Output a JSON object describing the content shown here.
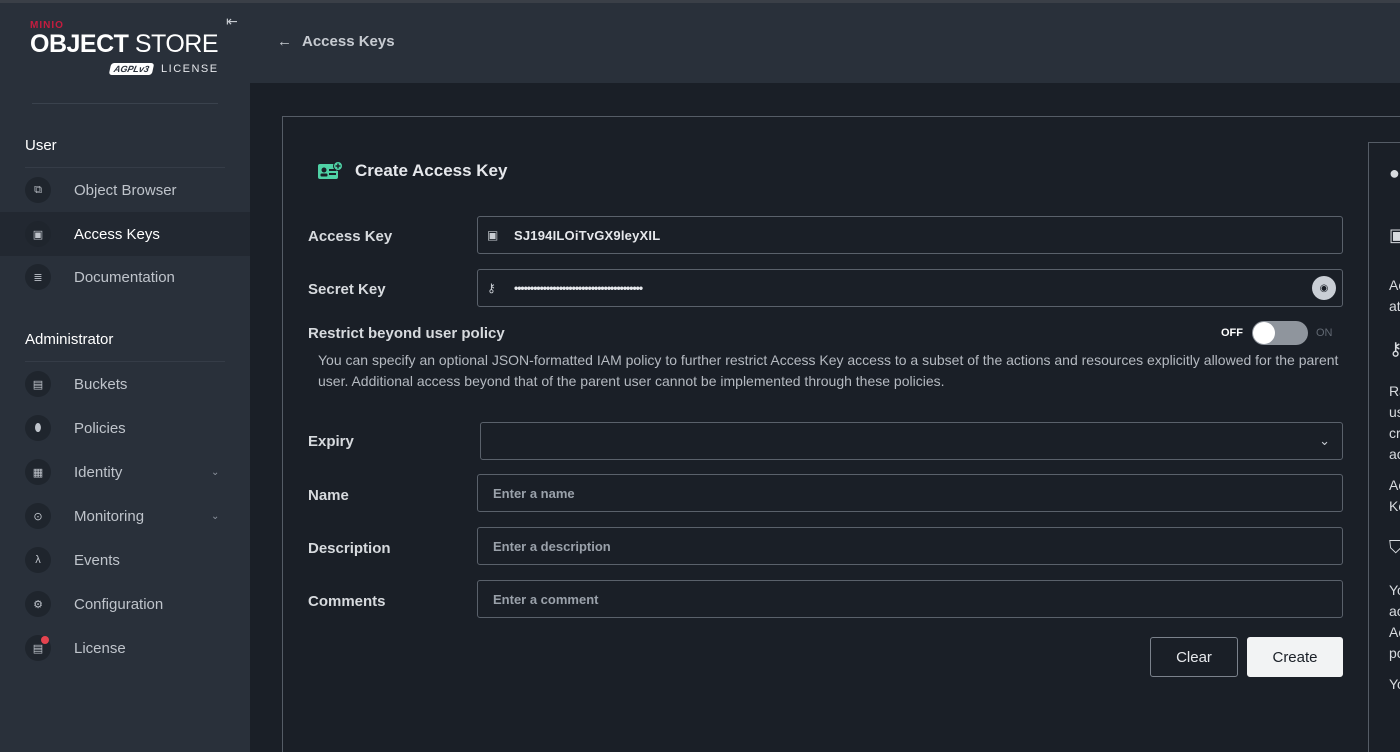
{
  "brand": {
    "minio": "MINIO",
    "product_bold": "OBJECT",
    "product_light": "STORE",
    "agpl": "AGPLv3",
    "license_label": "LICENSE"
  },
  "sidebar": {
    "user_section": "User",
    "user_items": [
      {
        "label": "Object Browser",
        "icon": "object-browser-icon"
      },
      {
        "label": "Access Keys",
        "icon": "access-keys-icon",
        "active": true
      },
      {
        "label": "Documentation",
        "icon": "documentation-icon"
      }
    ],
    "admin_section": "Administrator",
    "admin_items": [
      {
        "label": "Buckets",
        "icon": "buckets-icon"
      },
      {
        "label": "Policies",
        "icon": "policies-icon"
      },
      {
        "label": "Identity",
        "icon": "identity-icon",
        "expandable": true
      },
      {
        "label": "Monitoring",
        "icon": "monitoring-icon",
        "expandable": true
      },
      {
        "label": "Events",
        "icon": "events-icon"
      },
      {
        "label": "Configuration",
        "icon": "configuration-icon"
      },
      {
        "label": "License",
        "icon": "license-icon",
        "badge": true
      }
    ]
  },
  "header": {
    "back_label": "Access Keys"
  },
  "form": {
    "title": "Create Access Key",
    "access_key_label": "Access Key",
    "access_key_value": "SJ194ILOiTvGX9leyXIL",
    "secret_key_label": "Secret Key",
    "secret_key_value": "••••••••••••••••••••••••••••••••••••••••",
    "restrict_label": "Restrict beyond user policy",
    "toggle_off": "OFF",
    "toggle_on": "ON",
    "restrict_help": "You can specify an optional JSON-formatted IAM policy to further restrict Access Key access to a subset of the actions and resources explicitly allowed for the parent user. Additional access beyond that of the parent user cannot be implemented through these policies.",
    "expiry_label": "Expiry",
    "expiry_value": "",
    "name_label": "Name",
    "name_placeholder": "Enter a name",
    "description_label": "Description",
    "description_placeholder": "Enter a description",
    "comments_label": "Comments",
    "comments_placeholder": "Enter a comment",
    "clear_label": "Clear",
    "create_label": "Create"
  },
  "right_panel": {
    "lines": [
      "Ac",
      "at",
      "Ra",
      "us",
      "cr",
      "ac",
      "Ac",
      "Ke",
      "Yo",
      "ac",
      "Ac",
      "pc",
      "Yo"
    ]
  },
  "colors": {
    "sidebar_bg": "#29303a",
    "page_bg": "#1a1f27",
    "accent_green": "#4fd1a5",
    "badge_red": "#e5434f"
  }
}
